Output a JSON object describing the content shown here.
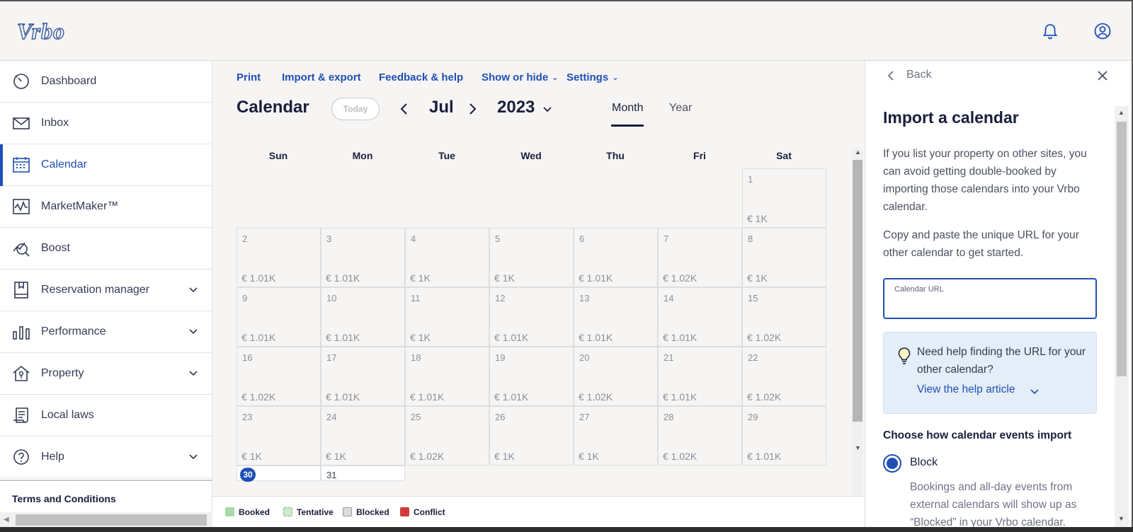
{
  "app": {
    "brand": "Vrbo",
    "colors": {
      "accent": "#1f4fb5",
      "text": "#191e3b",
      "bg": "#f6f5f4"
    }
  },
  "header": {
    "icons": [
      "bell-icon",
      "user-account-icon"
    ]
  },
  "sidebar": {
    "items": [
      {
        "label": "Dashboard",
        "icon": "dashboard-icon",
        "has_chevron": false,
        "active": false
      },
      {
        "label": "Inbox",
        "icon": "mail-icon",
        "has_chevron": false,
        "active": false
      },
      {
        "label": "Calendar",
        "icon": "calendar-icon",
        "has_chevron": false,
        "active": true
      },
      {
        "label": "MarketMaker™",
        "icon": "chart-line-icon",
        "has_chevron": false,
        "active": false
      },
      {
        "label": "Boost",
        "icon": "boost-icon",
        "has_chevron": false,
        "active": false
      },
      {
        "label": "Reservation manager",
        "icon": "book-icon",
        "has_chevron": true,
        "active": false
      },
      {
        "label": "Performance",
        "icon": "bar-chart-icon",
        "has_chevron": true,
        "active": false
      },
      {
        "label": "Property",
        "icon": "house-icon",
        "has_chevron": true,
        "active": false
      },
      {
        "label": "Local laws",
        "icon": "document-icon",
        "has_chevron": false,
        "active": false
      },
      {
        "label": "Help",
        "icon": "help-icon",
        "has_chevron": true,
        "active": false
      }
    ],
    "terms": "Terms and Conditions"
  },
  "toolbar": {
    "print": "Print",
    "import_export": "Import & export",
    "feedback": "Feedback & help",
    "show_hide": "Show or hide",
    "settings": "Settings"
  },
  "calendar": {
    "title": "Calendar",
    "today_btn": "Today",
    "month": "Jul",
    "year": "2023",
    "view_month": "Month",
    "view_year": "Year",
    "weekdays": [
      "Sun",
      "Mon",
      "Tue",
      "Wed",
      "Thu",
      "Fri",
      "Sat"
    ],
    "weeks": [
      [
        null,
        null,
        null,
        null,
        null,
        null,
        {
          "day": "1",
          "price": "€ 1K"
        }
      ],
      [
        {
          "day": "2",
          "price": "€ 1.01K"
        },
        {
          "day": "3",
          "price": "€ 1.01K"
        },
        {
          "day": "4",
          "price": "€ 1K"
        },
        {
          "day": "5",
          "price": "€ 1K"
        },
        {
          "day": "6",
          "price": "€ 1.01K"
        },
        {
          "day": "7",
          "price": "€ 1.02K"
        },
        {
          "day": "8",
          "price": "€ 1K"
        }
      ],
      [
        {
          "day": "9",
          "price": "€ 1.01K"
        },
        {
          "day": "10",
          "price": "€ 1.01K"
        },
        {
          "day": "11",
          "price": "€ 1K"
        },
        {
          "day": "12",
          "price": "€ 1.01K"
        },
        {
          "day": "13",
          "price": "€ 1.01K"
        },
        {
          "day": "14",
          "price": "€ 1.01K"
        },
        {
          "day": "15",
          "price": "€ 1.02K"
        }
      ],
      [
        {
          "day": "16",
          "price": "€ 1.02K"
        },
        {
          "day": "17",
          "price": "€ 1.01K"
        },
        {
          "day": "18",
          "price": "€ 1.01K"
        },
        {
          "day": "19",
          "price": "€ 1.01K"
        },
        {
          "day": "20",
          "price": "€ 1.02K"
        },
        {
          "day": "21",
          "price": "€ 1.01K"
        },
        {
          "day": "22",
          "price": "€ 1.02K"
        }
      ],
      [
        {
          "day": "23",
          "price": "€ 1K"
        },
        {
          "day": "24",
          "price": "€ 1K"
        },
        {
          "day": "25",
          "price": "€ 1.02K"
        },
        {
          "day": "26",
          "price": "€ 1K"
        },
        {
          "day": "27",
          "price": "€ 1K"
        },
        {
          "day": "28",
          "price": "€ 1.02K"
        },
        {
          "day": "29",
          "price": "€ 1.01K"
        }
      ],
      [
        {
          "day": "30",
          "price": "",
          "today": true
        },
        {
          "day": "31",
          "price": ""
        },
        null,
        null,
        null,
        null,
        null
      ]
    ],
    "legend": [
      {
        "label": "Booked",
        "color": "#a8d8a8"
      },
      {
        "label": "Tentative",
        "color": "#cfe9cf"
      },
      {
        "label": "Blocked",
        "color": "#dcdcdc"
      },
      {
        "label": "Conflict",
        "color": "#d23b3b"
      }
    ]
  },
  "panel": {
    "back": "Back",
    "title": "Import a calendar",
    "para1": "If you list your property on other sites, you can avoid getting double-booked by importing those calendars into your Vrbo calendar.",
    "para2": "Copy and paste the unique URL for your other calendar to get started.",
    "url_label": "Calendar URL",
    "url_value": "",
    "help_text": "Need help finding the URL for your other calendar?",
    "help_link": "View the help article",
    "subtitle": "Choose how calendar events import",
    "option_label": "Block",
    "option_desc": "Bookings and all-day events from external calendars will show up as “Blocked” in your Vrbo calendar."
  }
}
